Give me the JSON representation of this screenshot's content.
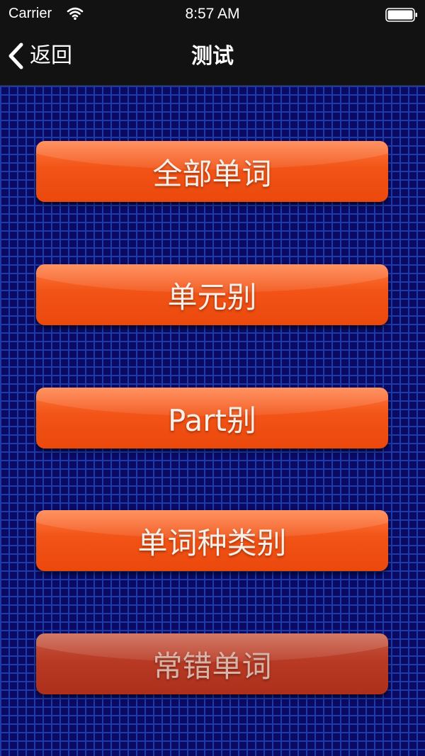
{
  "status_bar": {
    "carrier": "Carrier",
    "time": "8:57 AM",
    "wifi_icon": "wifi-icon",
    "battery_icon": "battery-icon"
  },
  "nav": {
    "back_label": "返回",
    "back_icon": "chevron-left-icon",
    "title": "测试"
  },
  "menu": {
    "items": [
      {
        "label": "全部单词",
        "enabled": true
      },
      {
        "label": "单元别",
        "enabled": true
      },
      {
        "label": "Part别",
        "enabled": true
      },
      {
        "label": "单词种类别",
        "enabled": true
      },
      {
        "label": "常错单词",
        "enabled": false
      }
    ]
  },
  "colors": {
    "button_orange": "#f25316",
    "button_dim": "#b83a24",
    "background_navy": "#0a0a66",
    "grid_blue": "#1e3aa4",
    "bar_black": "#121212"
  }
}
